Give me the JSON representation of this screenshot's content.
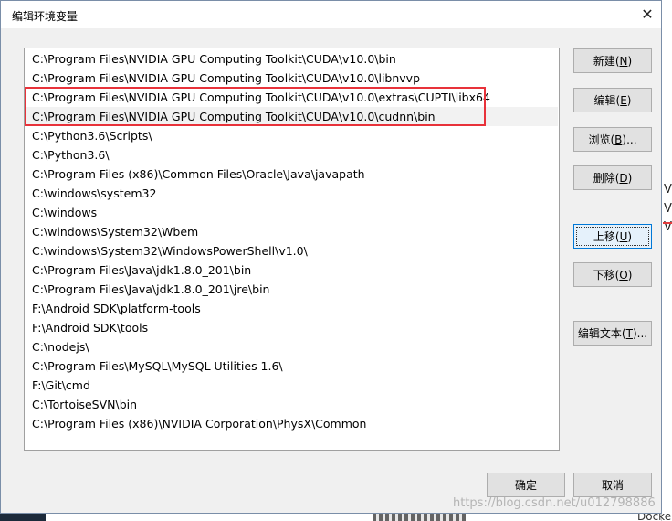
{
  "dialog": {
    "title": "编辑环境变量",
    "close_glyph": "✕"
  },
  "paths": [
    "C:\\Program Files\\NVIDIA GPU Computing Toolkit\\CUDA\\v10.0\\bin",
    "C:\\Program Files\\NVIDIA GPU Computing Toolkit\\CUDA\\v10.0\\libnvvp",
    "C:\\Program Files\\NVIDIA GPU Computing Toolkit\\CUDA\\v10.0\\extras\\CUPTI\\libx64",
    "C:\\Program Files\\NVIDIA GPU Computing Toolkit\\CUDA\\v10.0\\cudnn\\bin",
    "C:\\Python3.6\\Scripts\\",
    "C:\\Python3.6\\",
    "C:\\Program Files (x86)\\Common Files\\Oracle\\Java\\javapath",
    "C:\\windows\\system32",
    "C:\\windows",
    "C:\\windows\\System32\\Wbem",
    "C:\\windows\\System32\\WindowsPowerShell\\v1.0\\",
    "C:\\Program Files\\Java\\jdk1.8.0_201\\bin",
    "C:\\Program Files\\Java\\jdk1.8.0_201\\jre\\bin",
    "F:\\Android SDK\\platform-tools",
    "F:\\Android SDK\\tools",
    "C:\\nodejs\\",
    "C:\\Program Files\\MySQL\\MySQL Utilities 1.6\\",
    "F:\\Git\\cmd",
    "C:\\TortoiseSVN\\bin",
    "C:\\Program Files (x86)\\NVIDIA Corporation\\PhysX\\Common"
  ],
  "selected_index": 3,
  "buttons": {
    "new": {
      "label": "新建(",
      "key": "N",
      "end": ")"
    },
    "edit": {
      "label": "编辑(",
      "key": "E",
      "end": ")"
    },
    "browse": {
      "label": "浏览(",
      "key": "B",
      "end": ")..."
    },
    "delete": {
      "label": "删除(",
      "key": "D",
      "end": ")"
    },
    "move_up": {
      "label": "上移(",
      "key": "U",
      "end": ")"
    },
    "move_down": {
      "label": "下移(",
      "key": "O",
      "end": ")"
    },
    "edit_text": {
      "label": "编辑文本(",
      "key": "T",
      "end": ")..."
    },
    "ok": "确定",
    "cancel": "取消"
  },
  "background": {
    "right_letters": [
      "V",
      "V",
      "V"
    ],
    "bottom_text": "Docke",
    "watermark": "https://blog.csdn.net/u012798886"
  },
  "colors": {
    "highlight_border": "#e8323a",
    "focus_border": "#0078d7"
  }
}
